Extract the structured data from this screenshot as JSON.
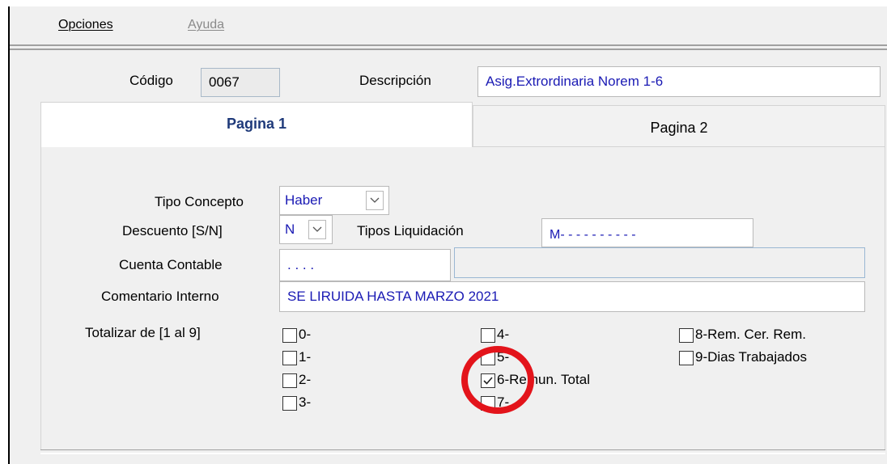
{
  "menu": {
    "items": [
      {
        "label": "Opciones",
        "enabled": true
      },
      {
        "label": "Ayuda",
        "enabled": false
      }
    ]
  },
  "header": {
    "codigo_label": "Código",
    "codigo_value": "0067",
    "descripcion_label": "Descripción",
    "descripcion_value": "Asig.Extrordinaria Norem 1-6"
  },
  "tabs": [
    {
      "label": "Pagina 1",
      "active": true
    },
    {
      "label": "Pagina 2",
      "active": false
    }
  ],
  "form": {
    "tipo_concepto_label": "Tipo Concepto",
    "tipo_concepto_value": "Haber",
    "descuento_label": "Descuento [S/N]",
    "descuento_value": "N",
    "tipos_liquidacion_label": "Tipos Liquidación",
    "tipos_liquidacion_value": "M- - - - - - - - - -",
    "cuenta_contable_label": "Cuenta Contable",
    "cuenta_contable_value": ". . . .",
    "cuenta_contable_desc": "",
    "comentario_label": "Comentario Interno",
    "comentario_value": "SE LIRUIDA HASTA MARZO 2021",
    "totalizar_label": "Totalizar de [1 al  9]"
  },
  "checkboxes": [
    {
      "label": "0-",
      "checked": false
    },
    {
      "label": "1-",
      "checked": false
    },
    {
      "label": "2-",
      "checked": false
    },
    {
      "label": "3-",
      "checked": false
    },
    {
      "label": "4-",
      "checked": false
    },
    {
      "label": "5-",
      "checked": false
    },
    {
      "label": "6-Remun. Total",
      "checked": true
    },
    {
      "label": "7-",
      "checked": false
    },
    {
      "label": "8-Rem. Cer. Rem.",
      "checked": false
    },
    {
      "label": "9-Dias Trabajados",
      "checked": false
    }
  ],
  "colors": {
    "field_text": "#1a1ab4",
    "active_tab_text": "#1f3a7a",
    "highlight_circle": "#e3141b"
  }
}
